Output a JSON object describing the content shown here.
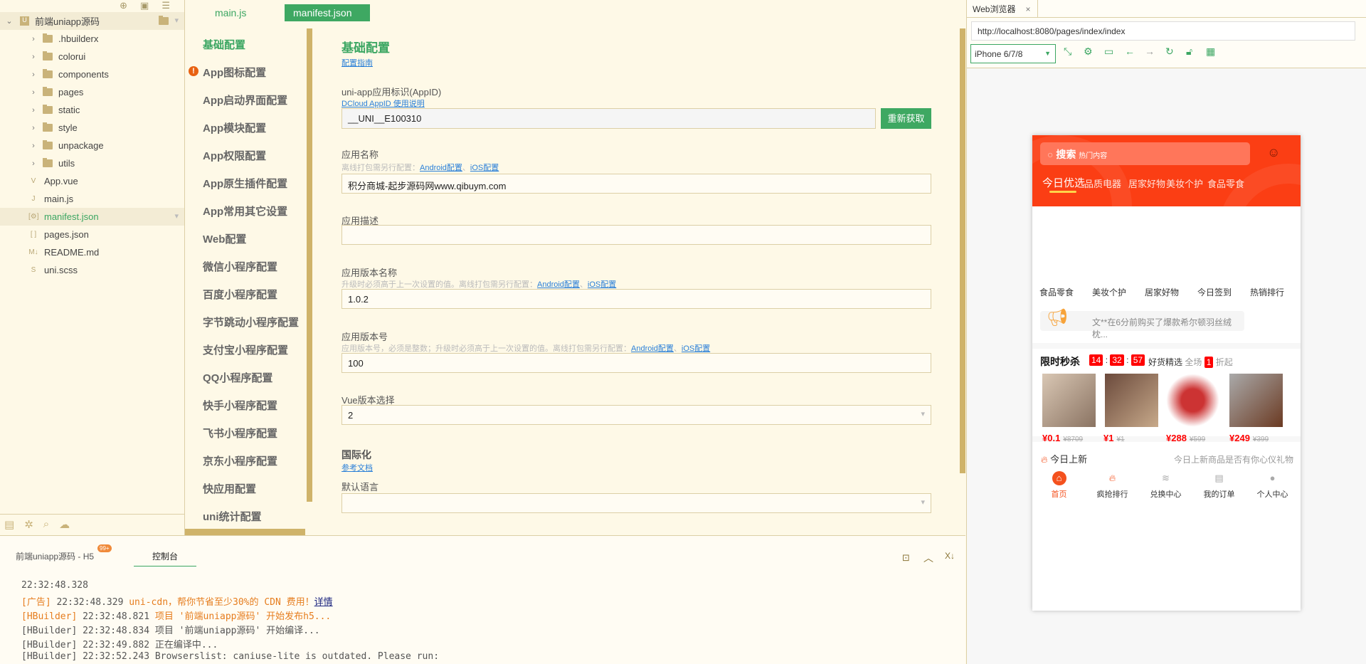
{
  "tree": {
    "project": "前端uniapp源码",
    "items": [
      {
        "name": ".hbuilderx",
        "type": "folder"
      },
      {
        "name": "colorui",
        "type": "folder"
      },
      {
        "name": "components",
        "type": "folder"
      },
      {
        "name": "pages",
        "type": "folder"
      },
      {
        "name": "static",
        "type": "folder"
      },
      {
        "name": "style",
        "type": "folder"
      },
      {
        "name": "unpackage",
        "type": "folder"
      },
      {
        "name": "utils",
        "type": "folder"
      },
      {
        "name": "App.vue",
        "type": "file",
        "icon": "V"
      },
      {
        "name": "main.js",
        "type": "file",
        "icon": "J"
      },
      {
        "name": "manifest.json",
        "type": "file",
        "icon": "[⚙]"
      },
      {
        "name": "pages.json",
        "type": "file",
        "icon": "[ ]"
      },
      {
        "name": "README.md",
        "type": "file",
        "icon": "M↓"
      },
      {
        "name": "uni.scss",
        "type": "file",
        "icon": "S"
      }
    ]
  },
  "editor_tabs": [
    "main.js",
    "manifest.json"
  ],
  "nav": [
    "基础配置",
    "App图标配置",
    "App启动界面配置",
    "App模块配置",
    "App权限配置",
    "App原生插件配置",
    "App常用其它设置",
    "Web配置",
    "微信小程序配置",
    "百度小程序配置",
    "字节跳动小程序配置",
    "支付宝小程序配置",
    "QQ小程序配置",
    "快手小程序配置",
    "飞书小程序配置",
    "京东小程序配置",
    "快应用配置",
    "uni统计配置"
  ],
  "form": {
    "title": "基础配置",
    "guide": "配置指南",
    "appid_label": "uni-app应用标识(AppID)",
    "appid_link": "DCloud AppID 使用说明",
    "appid_value": "__UNI__E100310",
    "refresh": "重新获取",
    "name_label": "应用名称",
    "name_hint": "离线打包需另行配置：",
    "android": "Android配置",
    "sep": "、",
    "ios": "iOS配置",
    "name_value": "积分商城-起步源码网www.qibuym.com",
    "desc_label": "应用描述",
    "vname_label": "应用版本名称",
    "vname_hint": "升级时必须高于上一次设置的值。离线打包需另行配置：",
    "vname_value": "1.0.2",
    "vcode_label": "应用版本号",
    "vcode_hint": "应用版本号，必须是整数；升级时必须高于上一次设置的值。离线打包需另行配置：",
    "vcode_value": "100",
    "vue_label": "Vue版本选择",
    "vue_value": "2",
    "i18n_title": "国际化",
    "i18n_link": "参考文档",
    "lang_label": "默认语言"
  },
  "bottom": {
    "tab1": "前端uniapp源码 - H5",
    "badge": "99+",
    "tab2": "控制台",
    "logs": [
      {
        "prefix": "",
        "time": "22:32:48.328",
        "msg": ""
      },
      {
        "prefix": "[广告]",
        "time": "22:32:48.329",
        "msg": "uni-cdn，帮你节省至少30%的 CDN 费用！",
        "link": "详情"
      },
      {
        "prefix": "[HBuilder]",
        "time": "22:32:48.821",
        "msg": "项目 '前端uniapp源码' 开始发布h5..."
      },
      {
        "prefix": "[HBuilder]",
        "time": "22:32:48.834",
        "msg": "项目 '前端uniapp源码' 开始编译..."
      },
      {
        "prefix": "[HBuilder]",
        "time": "22:32:49.882",
        "msg": "正在编译中..."
      },
      {
        "prefix": "[HBuilder]",
        "time": "22:32:52.243",
        "msg": "Browserslist: caniuse-lite is outdated. Please run:"
      }
    ]
  },
  "browser": {
    "tab": "Web浏览器",
    "url": "http://localhost:8080/pages/index/index",
    "device": "iPhone 6/7/8"
  },
  "phone": {
    "search": "搜索",
    "search_hint": "热门内容",
    "tabs": [
      "今日优选",
      "品质电器",
      "居家好物",
      "美妆个护",
      "食品零食"
    ],
    "cats": [
      "食品零食",
      "美妆个护",
      "居家好物",
      "今日签到",
      "热销排行"
    ],
    "notice": "文**在6分前购买了爆款希尔顿羽丝绒枕...",
    "flash_title": "限时秒杀",
    "timer": [
      "14",
      "32",
      "57"
    ],
    "good_title": "好货精选",
    "good_sub1": "全场",
    "good_num": "1",
    "good_sub2": "折起",
    "products": [
      {
        "price": "¥0.1",
        "old": "¥8709"
      },
      {
        "price": "¥1",
        "old": "¥1"
      },
      {
        "price": "¥288",
        "old": "¥599"
      },
      {
        "price": "¥249",
        "old": "¥399"
      }
    ],
    "new_title": "今日上新",
    "new_sub": "今日上新商品是否有你心仪礼物",
    "tabbar": [
      "首页",
      "疯抢排行",
      "兑换中心",
      "我的订单",
      "个人中心"
    ]
  },
  "colors": {
    "accent": "#3ba662",
    "phone_red": "#fb3e14",
    "gold": "#cfb36a"
  }
}
